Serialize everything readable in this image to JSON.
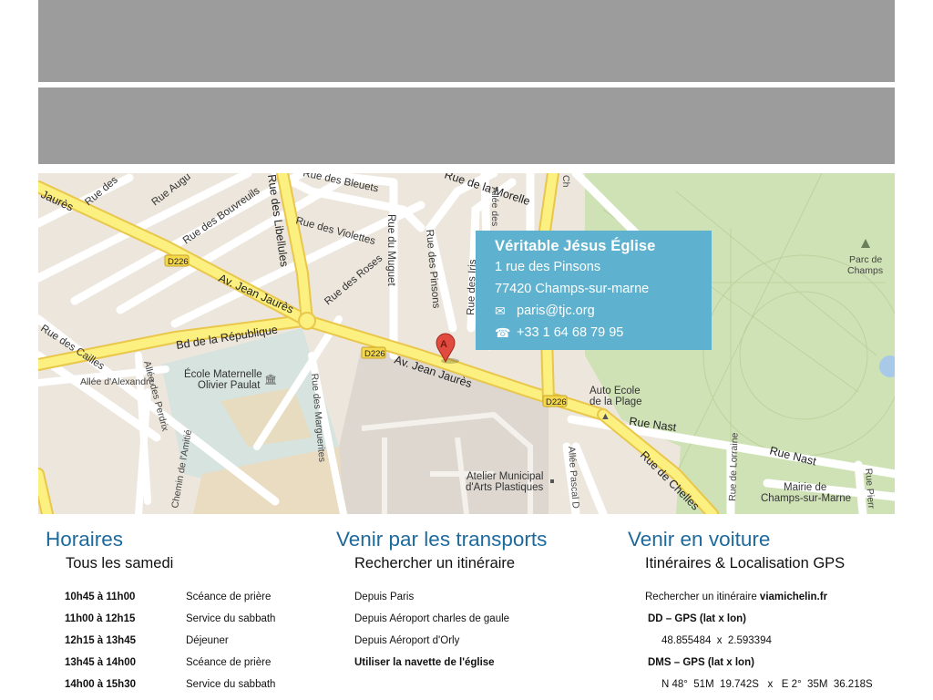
{
  "map": {
    "labels": {
      "rue_des_bleuets": "Rue des Bleuets",
      "rue_de_la_morelle": "Rue de la Morelle",
      "rue_des_bouvreuils": "Rue des Bouvreuils",
      "rue_augu": "Rue Augu",
      "rue_des": "Rue des",
      "rue_des_libellules": "Rue des Libellules",
      "rue_des_violettes": "Rue des Violettes",
      "rue_du_muguet": "Rue du Muguet",
      "rue_des_pinsons": "Rue des Pinsons",
      "rue_des_iris": "Rue des Iris",
      "allee_des": "Allée des",
      "rue_des_roses": "Rue des Roses",
      "av_jean_jaures_1": "Av. Jean Jaurès",
      "av_jean_jaures_2": "Av. Jean Jaurès",
      "jaures_edge": "Jaurès",
      "bd_republique": "Bd de la République",
      "rue_caille": "Rue des Cailles",
      "allee_alexandre": "Allée d'Alexandre",
      "allee_des_perdrix": "Allée des Perdrix",
      "ecole_maternelle_1": "École Maternelle",
      "ecole_maternelle_2": "Olivier Paulat",
      "rue_des_marguerites": "Rue des Marguerites",
      "chemin_amitie": "Chemin de l'Amitié",
      "atelier_1": "Atelier Municipal",
      "atelier_2": "d'Arts Plastiques",
      "allee_pascal_d": "Allée Pascal D",
      "auto_ecole_1": "Auto Ecole",
      "auto_ecole_2": "de la Plage",
      "rue_nast_1": "Rue Nast",
      "rue_nast_2": "Rue Nast",
      "rue_de_chelles": "Rue de Chelles",
      "rue_de_lorraine": "Rue de Lorraine",
      "mairie_1": "Mairie de",
      "mairie_2": "Champs-sur-Marne",
      "rue_pierre": "Rue Pierr",
      "parc_1": "Parc de",
      "parc_2": "Champs",
      "d226_1": "D226",
      "d226_2": "D226",
      "d226_3": "D226",
      "marker": "A",
      "ch": "Ch"
    }
  },
  "info": {
    "title": "Véritable Jésus Église",
    "address1": "1 rue des Pinsons",
    "address2": "77420 Champs-sur-marne",
    "email_icon": "envelope-icon",
    "email": "paris@tjc.org",
    "phone_icon": "telephone-icon",
    "phone": "+33 1 64 68 79 95"
  },
  "horaires": {
    "title": "Horaires",
    "subtitle": "Tous les samedi",
    "rows": [
      {
        "time": "10h45 à 11h00",
        "activity": "Scéance de prière"
      },
      {
        "time": "11h00 à 12h15",
        "activity": "Service du sabbath"
      },
      {
        "time": "12h15 à 13h45",
        "activity": "Déjeuner"
      },
      {
        "time": "13h45 à 14h00",
        "activity": "Scéance de prière"
      },
      {
        "time": "14h00 à 15h30",
        "activity": "Service du sabbath"
      }
    ]
  },
  "transports": {
    "title": "Venir par les transports",
    "subtitle": "Rechercher un itinéraire",
    "items": [
      "Depuis Paris",
      "Depuis Aéroport charles de gaule",
      "Depuis Aéroport d'Orly",
      "Utiliser la navette de l'église"
    ]
  },
  "voiture": {
    "title": "Venir en voiture",
    "subtitle": "Itinéraires & Localisation GPS",
    "search_prefix": "Rechercher un itinéraire ",
    "search_link": "viamichelin.fr",
    "dd_label": "DD – GPS (lat x lon)",
    "dd_value": "48.855484  x  2.593394",
    "dms_label": "DMS – GPS (lat x lon)",
    "dms_value": "N 48°  51M  19.742S   x   E 2°  35M  36.218S"
  }
}
